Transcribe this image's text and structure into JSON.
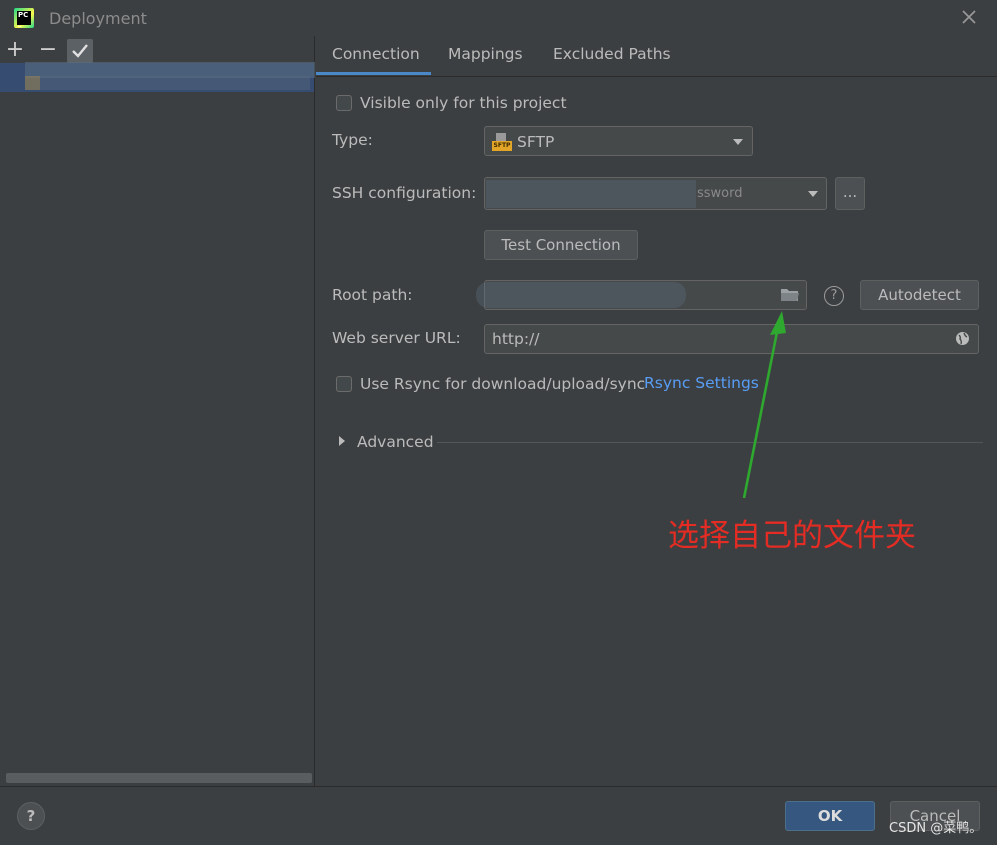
{
  "window": {
    "title": "Deployment"
  },
  "left_panel": {
    "add_label": "+",
    "remove_label": "−"
  },
  "tabs": [
    "Connection",
    "Mappings",
    "Excluded Paths"
  ],
  "connection": {
    "visible_only_label": "Visible only for this project",
    "type_label": "Type:",
    "type_value": "SFTP",
    "type_badge": "SFTP",
    "ssh_label": "SSH configuration:",
    "ssh_value_suffix": "ssword",
    "ellipsis_label": "...",
    "test_connection_label": "Test Connection",
    "root_path_label": "Root path:",
    "help_label": "?",
    "autodetect_label": "Autodetect",
    "web_url_label": "Web server URL:",
    "web_url_value": "http://",
    "rsync_label": "Use Rsync for download/upload/sync",
    "rsync_settings_label": "Rsync Settings",
    "advanced_label": "Advanced"
  },
  "annotation": {
    "text": "选择自己的文件夹",
    "color": "#e42c24",
    "arrow_color": "#2ea82e"
  },
  "footer": {
    "help_label": "?",
    "ok_label": "OK",
    "cancel_label": "Cancel",
    "watermark": "CSDN @菜鸭。"
  },
  "colors": {
    "accent": "#4a88c7",
    "ok_button": "#365880",
    "link": "#589df6"
  }
}
